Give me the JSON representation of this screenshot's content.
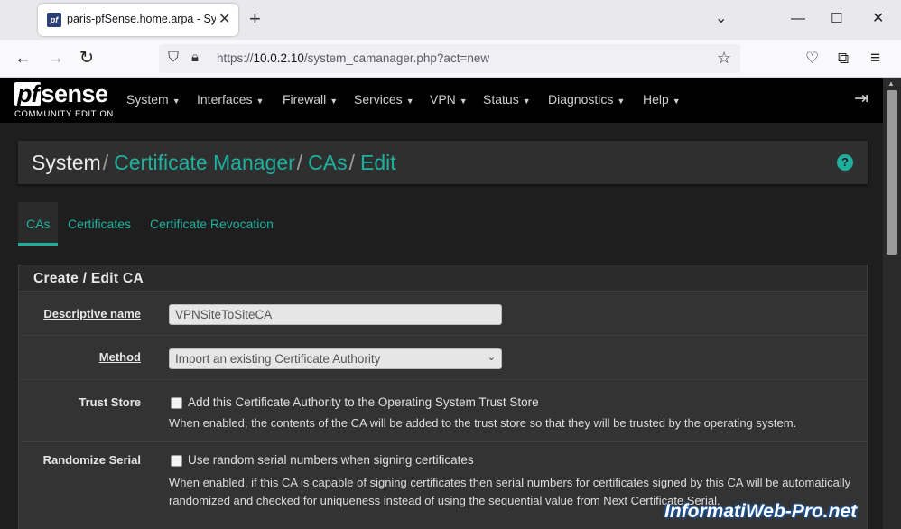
{
  "browser": {
    "tab_title": "paris-pfSense.home.arpa - Syst",
    "tab_favicon_text": "pf",
    "url_prefix": "https://",
    "url_host": "10.0.2.10",
    "url_path": "/system_camanager.php?act=new"
  },
  "logo": {
    "pf": "pf",
    "sense": "sense",
    "edition": "COMMUNITY EDITION"
  },
  "menu": [
    "System",
    "Interfaces",
    "Firewall",
    "Services",
    "VPN",
    "Status",
    "Diagnostics",
    "Help"
  ],
  "breadcrumb": {
    "current": "System",
    "links": [
      "Certificate Manager",
      "CAs",
      "Edit"
    ]
  },
  "subtabs": [
    "CAs",
    "Certificates",
    "Certificate Revocation"
  ],
  "panel": {
    "title": "Create / Edit CA",
    "descriptive_name_label": "Descriptive name",
    "descriptive_name_value": "VPNSiteToSiteCA",
    "method_label": "Method",
    "method_value": "Import an existing Certificate Authority",
    "trust_store_label": "Trust Store",
    "trust_store_checkbox": "Add this Certificate Authority to the Operating System Trust Store",
    "trust_store_help": "When enabled, the contents of the CA will be added to the trust store so that they will be trusted by the operating system.",
    "randomize_label": "Randomize Serial",
    "randomize_checkbox": "Use random serial numbers when signing certificates",
    "randomize_help": "When enabled, if this CA is capable of signing certificates then serial numbers for certificates signed by this CA will be automatically randomized and checked for uniqueness instead of using the sequential value from Next Certificate Serial."
  },
  "watermark": "InformatiWeb-Pro.net",
  "colors": {
    "accent": "#1eaf9d",
    "nav_bg": "#000000",
    "page_bg": "#1e1e1e"
  }
}
